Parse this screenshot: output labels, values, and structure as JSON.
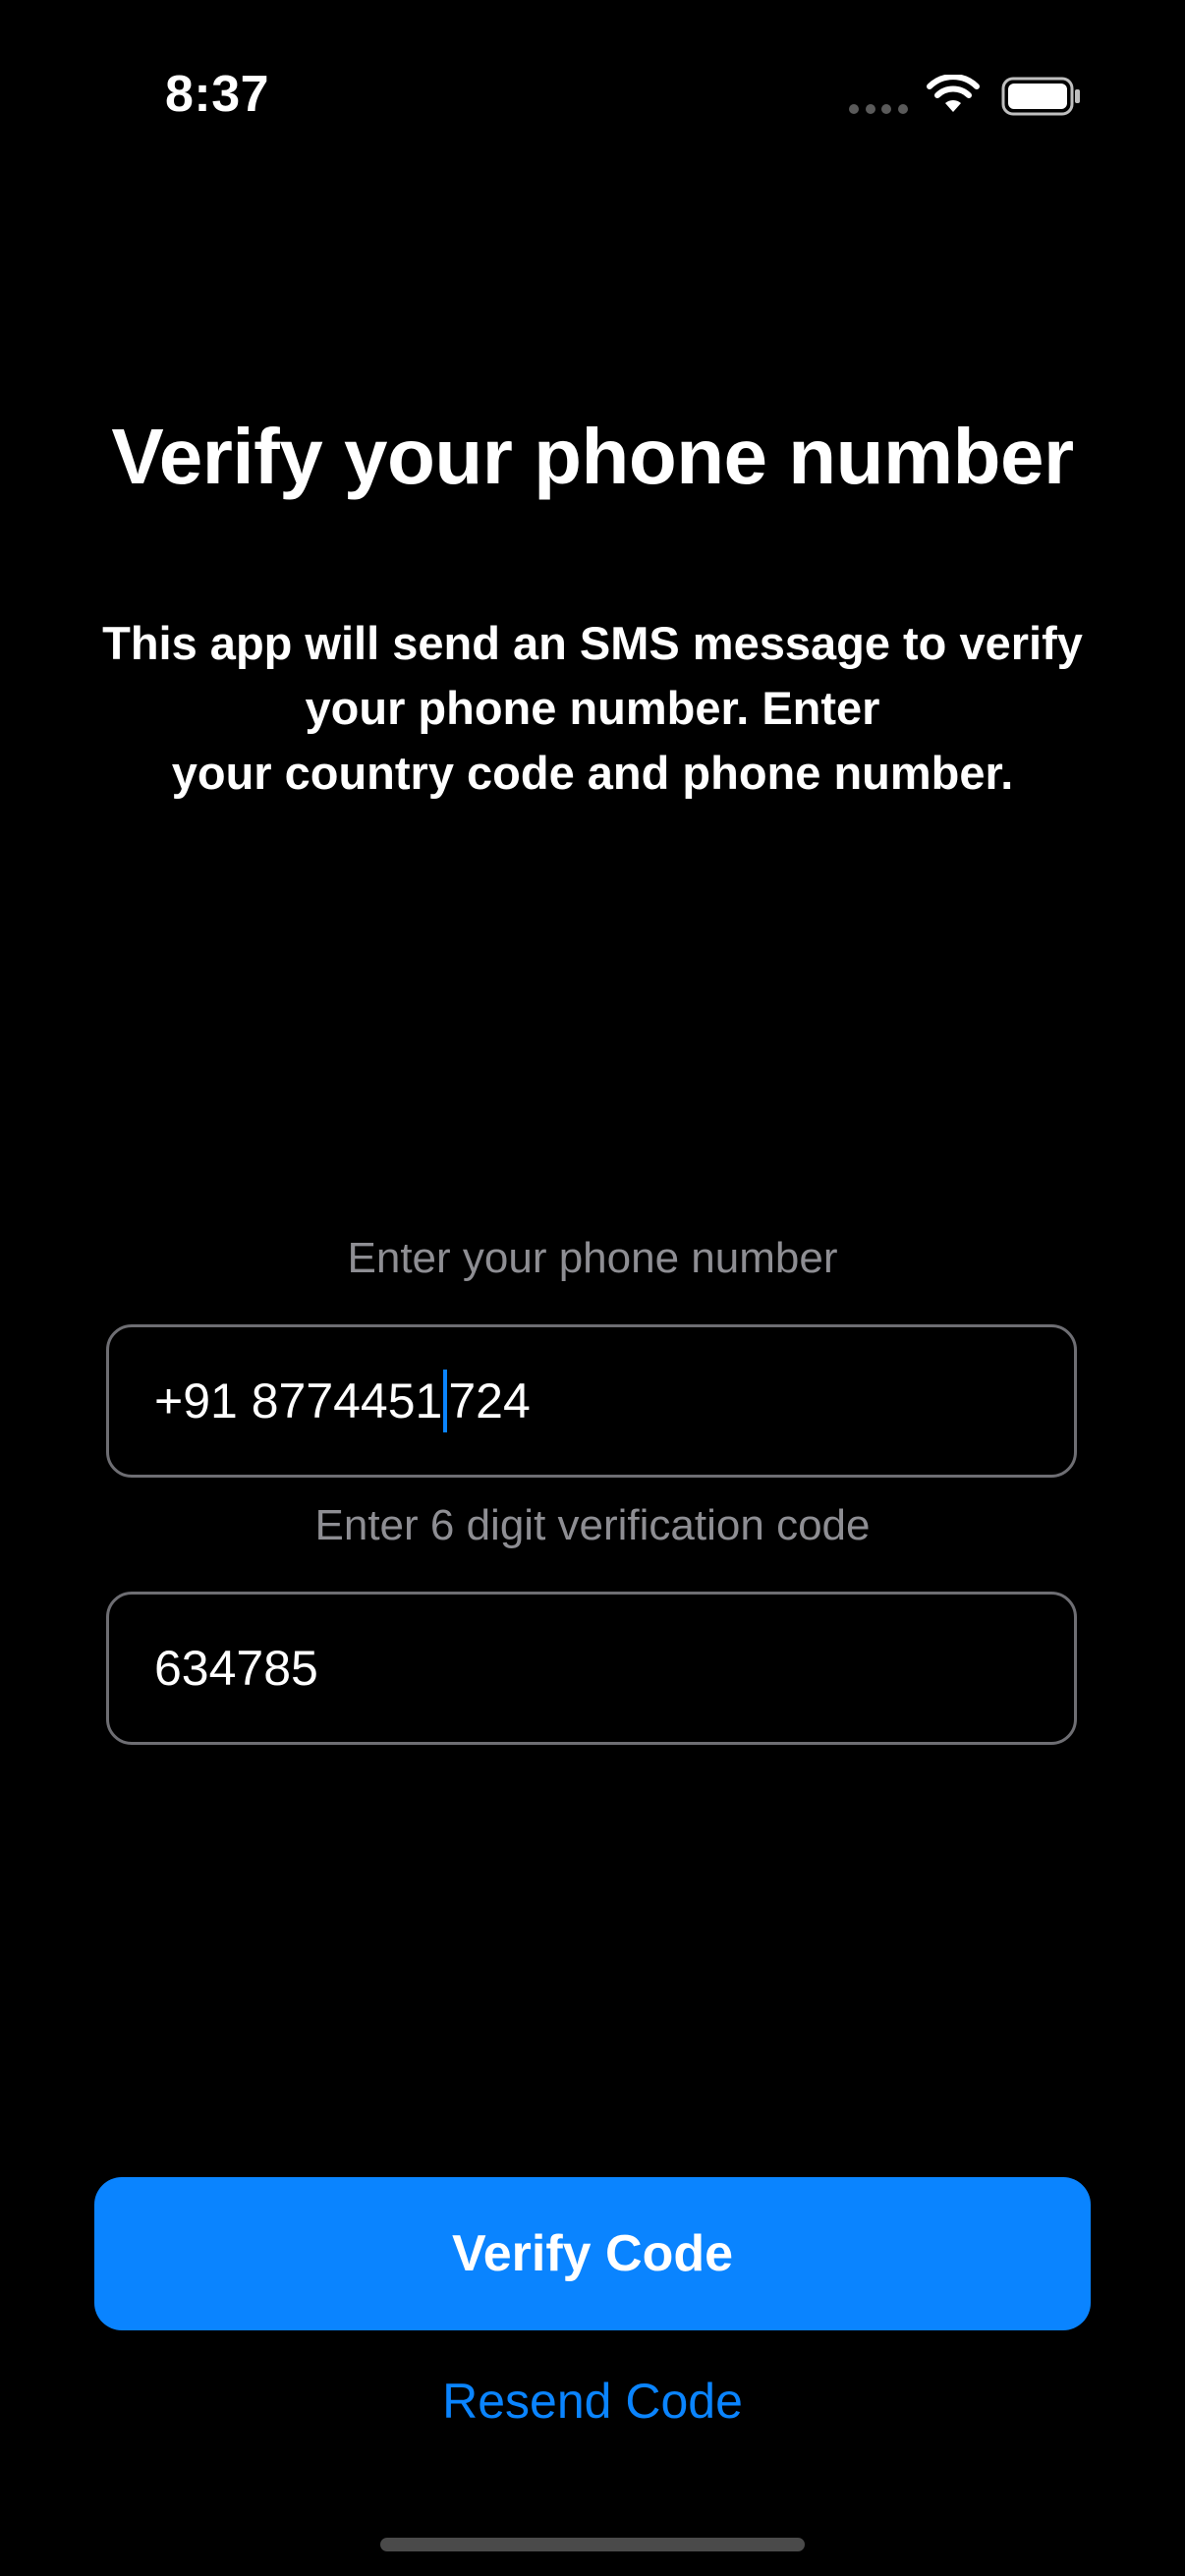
{
  "status_bar": {
    "time": "8:37",
    "icons": [
      "signal-dots-icon",
      "wifi-icon",
      "battery-icon"
    ]
  },
  "screen": {
    "title": "Verify your phone number",
    "description": "This app will send an SMS message to verify\nyour phone number. Enter\nyour country code and phone number."
  },
  "phone_field": {
    "label": "Enter your phone number",
    "value_before_caret": "+91 8774451",
    "value_after_caret": "724"
  },
  "code_field": {
    "label": "Enter 6 digit verification code",
    "value": "634785"
  },
  "actions": {
    "verify_label": "Verify Code",
    "resend_label": "Resend Code"
  },
  "colors": {
    "background": "#000000",
    "accent": "#0a84ff",
    "secondary_text": "#8e8e93",
    "field_border": "#6e6e73"
  }
}
